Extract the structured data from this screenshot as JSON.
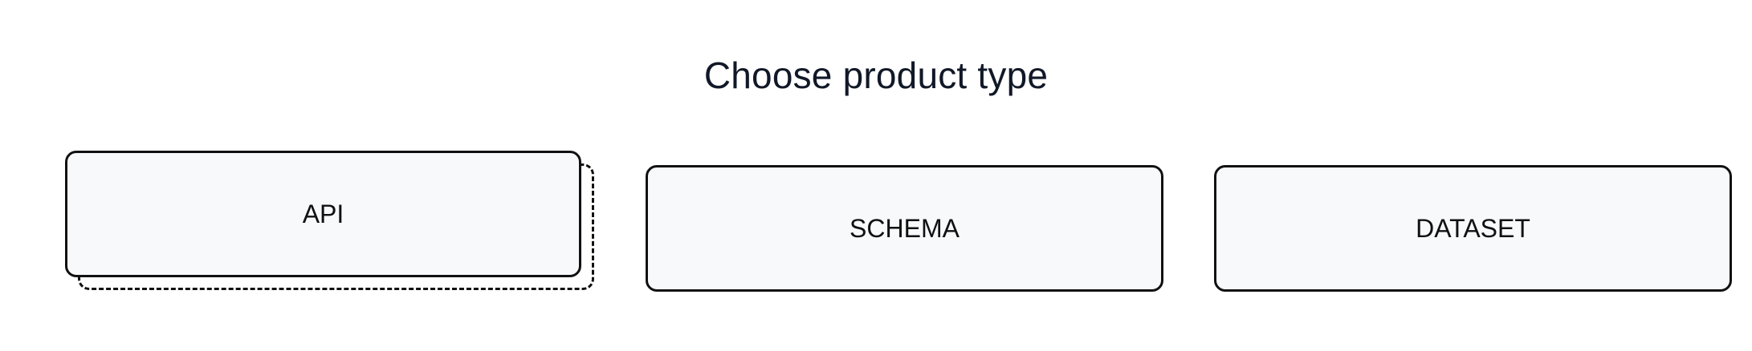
{
  "heading": "Choose product type",
  "options": [
    {
      "label": "API",
      "selected": true
    },
    {
      "label": "SCHEMA",
      "selected": false
    },
    {
      "label": "DATASET",
      "selected": false
    }
  ],
  "colors": {
    "text": "#111827",
    "card_background": "#f8f9fb",
    "card_border": "#111111",
    "page_background": "#ffffff"
  }
}
